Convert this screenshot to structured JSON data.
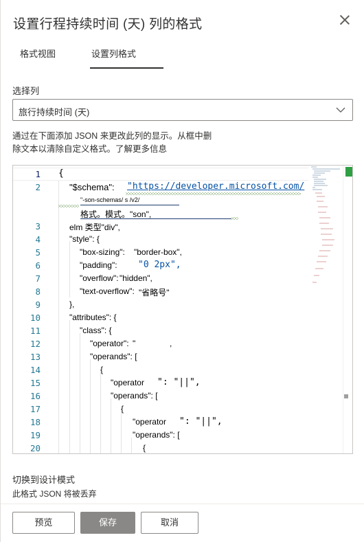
{
  "dialog": {
    "title": "设置行程持续时间 (天) 列的格式"
  },
  "tabs": [
    {
      "label": "格式视图"
    },
    {
      "label": "设置列格式"
    }
  ],
  "select_column": {
    "label": "选择列",
    "value": "旅行持续时间 (天)"
  },
  "description": {
    "line1": "通过在下面添加 JSON 来更改此列的显示。从框中删",
    "line2": "除文本以清除自定义格式。了解更多信息"
  },
  "editor": {
    "line_numbers": [
      "1",
      "2",
      "3",
      "4",
      "5",
      "6",
      "7",
      "8",
      "9",
      "10",
      "11",
      "12",
      "13",
      "14",
      "15",
      "16",
      "17",
      "18",
      "19",
      "20"
    ],
    "lines": {
      "l1": "{",
      "l2_key": "\"$schema\":",
      "l2_url": "\"https://developer.microsoft.com/",
      "l2_cont1": "\"-son-schemas/ s /v2/",
      "l2_cont2": "格式。模式。\"son\",",
      "l3": "elm 类型\"div\",",
      "l4": "\"style\": {",
      "l5_key": "\"box-sizing\":",
      "l5_val": "\"border-box\",",
      "l6_key": "\"padding\":",
      "l6_val": "\"0 2px\",",
      "l7_key": "\"overflow\":",
      "l7_val": "\"hidden\",",
      "l8_key": "\"text-overflow\":",
      "l8_val": "\"省略号\"",
      "l9": "},",
      "l10": "\"attributes\": {",
      "l11": "\"class\": {",
      "l12_key": "\"operator\":",
      "l12_val": "\"",
      "l12_end": ",",
      "l13": "\"operands\": [",
      "l14": "{",
      "l15_key": "\"operator",
      "l15_val": "\": \"||\",",
      "l16": "\"operands\": [",
      "l17": "{",
      "l18_key": "\"operator",
      "l18_val": "\": \"||\",",
      "l19": "\"operands\": [",
      "l20": "{"
    }
  },
  "design_mode": {
    "label": "切换到设计模式",
    "note": "此格式 JSON 将被丢弃"
  },
  "buttons": {
    "preview": "预览",
    "save": "保存",
    "cancel": "取消"
  },
  "colors": {
    "line_number": "#237893",
    "string": "#0451a5",
    "save_disabled": "#8a8886",
    "squiggle": "#6a9955"
  },
  "icons": {
    "close": "close-icon",
    "dropdown": "chevron-down-icon"
  }
}
